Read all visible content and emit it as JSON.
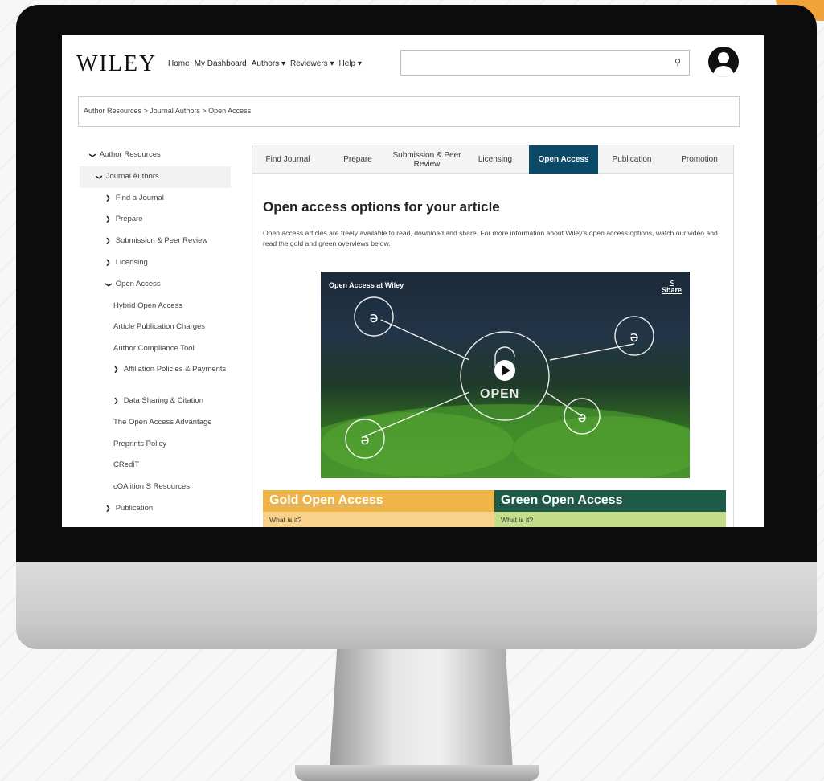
{
  "header": {
    "logo": "WILEY",
    "nav": [
      "Home",
      "My Dashboard",
      "Authors ▾",
      "Reviewers ▾",
      "Help ▾"
    ],
    "search_placeholder": ""
  },
  "breadcrumb": "Author Resources > Journal Authors > Open Access",
  "sidebar": {
    "items": [
      {
        "label": "Author Resources",
        "chev": "❯"
      },
      {
        "label": "Journal Authors",
        "chev": "❯"
      },
      {
        "label": "Find a Journal",
        "chev": "❯"
      },
      {
        "label": "Prepare",
        "chev": "❯"
      },
      {
        "label": "Submission & Peer Review",
        "chev": "❯"
      },
      {
        "label": "Licensing",
        "chev": "❯"
      },
      {
        "label": "Open Access",
        "chev": "❯"
      },
      {
        "label": "Hybrid Open Access"
      },
      {
        "label": "Article Publication Charges"
      },
      {
        "label": "Author Compliance Tool"
      },
      {
        "label": "Affiliation Policies & Payments",
        "chev": "❯"
      },
      {
        "label": "Data Sharing & Citation",
        "chev": "❯"
      },
      {
        "label": "The Open Access Advantage"
      },
      {
        "label": "Preprints Policy"
      },
      {
        "label": "CRediT"
      },
      {
        "label": "cOAlition S Resources"
      },
      {
        "label": "Publication",
        "chev": "❯"
      }
    ]
  },
  "tabs": [
    "Find Journal",
    "Prepare",
    "Submission & Peer Review",
    "Licensing",
    "Open Access",
    "Publication",
    "Promotion"
  ],
  "main": {
    "heading": "Open access options for your article",
    "intro": "Open access articles are freely available to read, download and share. For more information about Wiley's open access options, watch our video and read the gold and green overviews below.",
    "video": {
      "title": "Open Access at Wiley",
      "share": "Share",
      "overlay": "OPEN"
    },
    "gold": {
      "title": "Gold Open Access",
      "row": "What is it?"
    },
    "green": {
      "title": "Green Open Access",
      "row": "What is it?"
    }
  },
  "colors": {
    "active_tab": "#0b4a66",
    "gold": "#efb446",
    "green": "#1e5a48"
  }
}
